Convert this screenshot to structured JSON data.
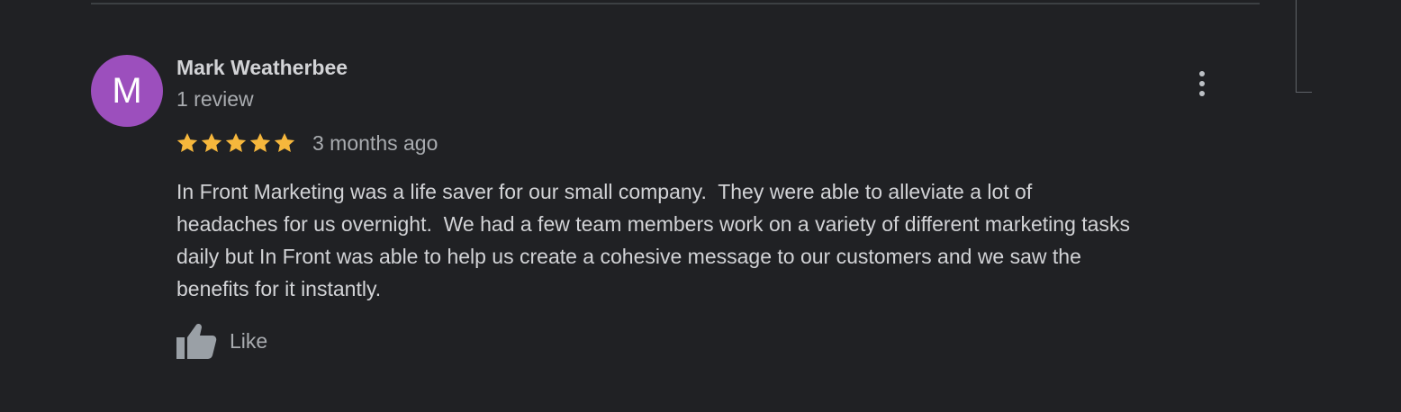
{
  "review": {
    "avatar_letter": "M",
    "avatar_color": "#9c4fbd",
    "reviewer_name": "Mark Weatherbee",
    "review_count": "1 review",
    "rating": 5,
    "rating_max": 5,
    "star_color": "#f6b73c",
    "time_ago": "3 months ago",
    "text": "In Front Marketing was a life saver for our small company.  They were able to alleviate a lot of\nheadaches for us overnight.  We had a few team members work on a variety of different marketing tasks\ndaily but In Front was able to help us create a cohesive message to our customers and we saw the\nbenefits for it instantly.",
    "like_label": "Like",
    "like_icon": "thumbs-up-icon",
    "more_icon": "more-vertical-icon"
  }
}
